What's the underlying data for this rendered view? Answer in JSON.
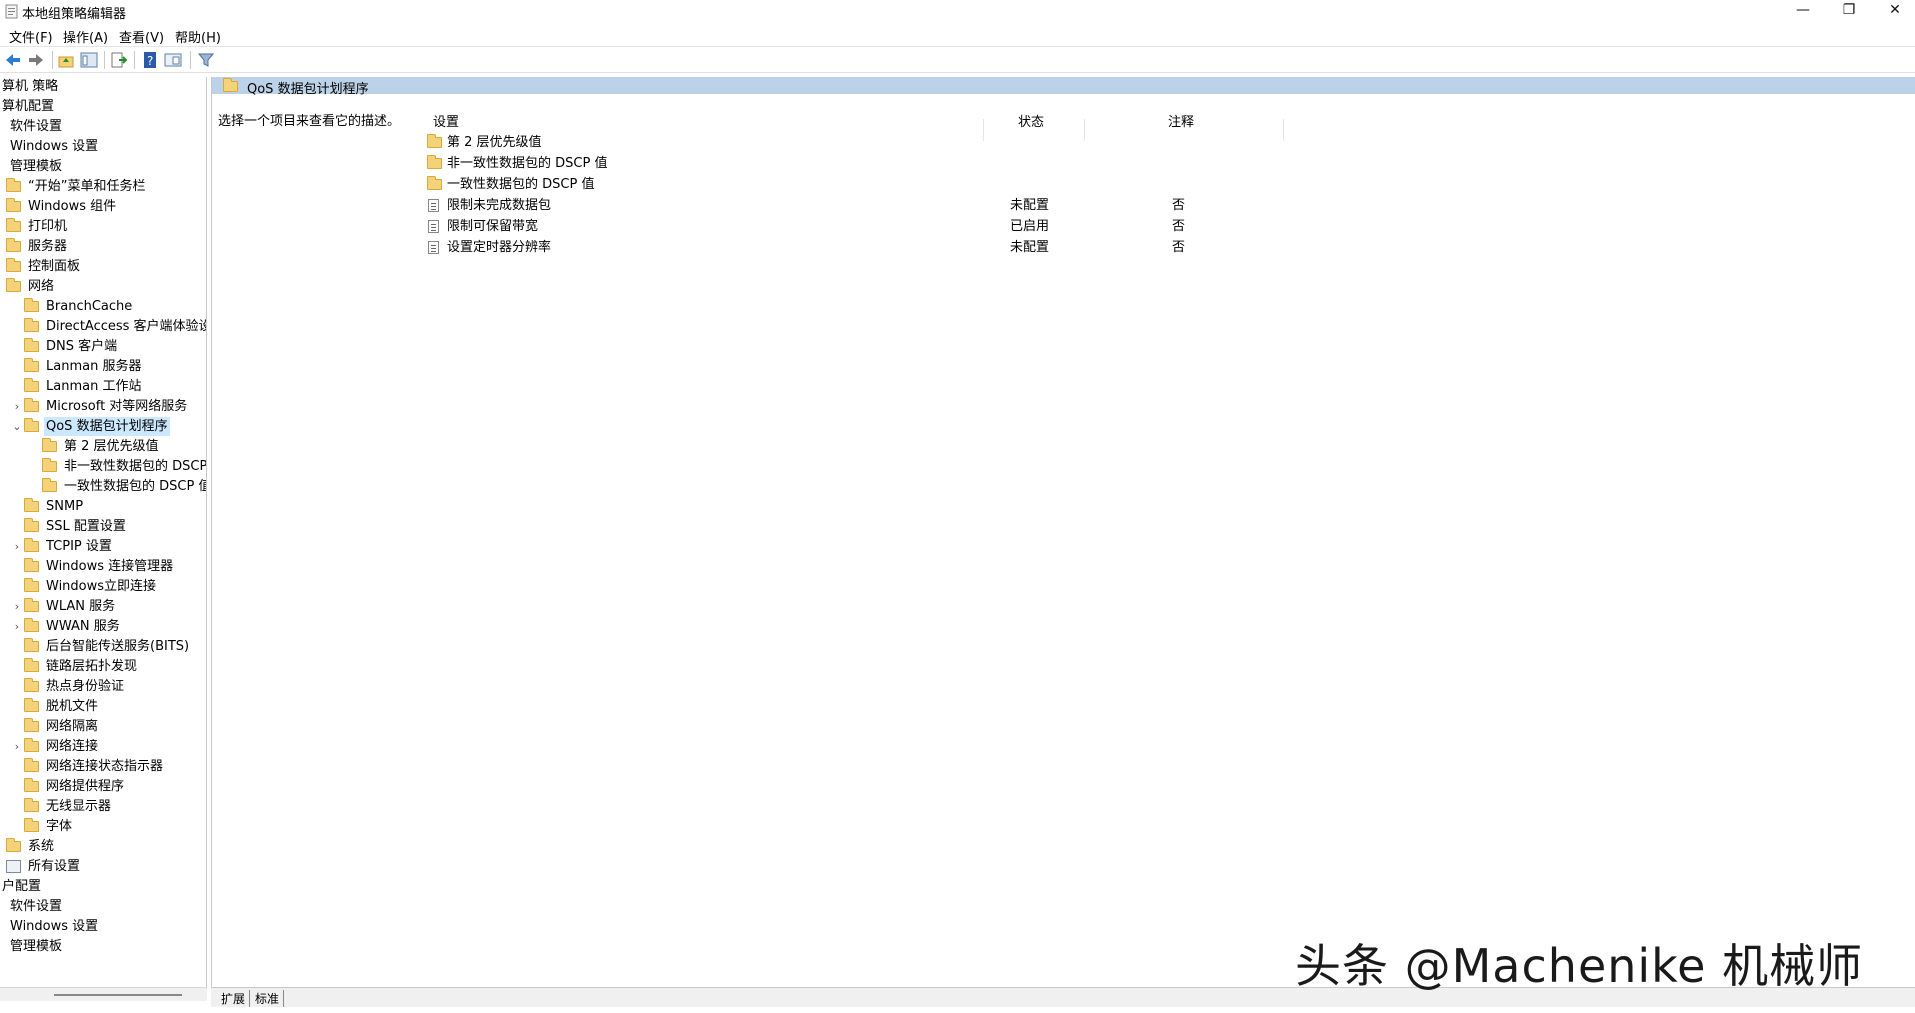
{
  "window": {
    "title": "本地组策略编辑器",
    "minimize_glyph": "—",
    "maximize_glyph": "❐",
    "close_glyph": "✕"
  },
  "menu": [
    "文件(F)",
    "操作(A)",
    "查看(V)",
    "帮助(H)"
  ],
  "toolbar": {
    "icons": [
      "back-arrow-icon",
      "forward-arrow-icon",
      "up-folder-icon",
      "show-hide-tree-icon",
      "export-list-icon",
      "help-icon",
      "properties-icon",
      "filter-icon"
    ]
  },
  "tree": {
    "items": [
      {
        "label": "算机 策略",
        "level": 0
      },
      {
        "label": "算机配置",
        "level": 0
      },
      {
        "label": "软件设置",
        "level": 1
      },
      {
        "label": "Windows 设置",
        "level": 1
      },
      {
        "label": "管理模板",
        "level": 1
      },
      {
        "label": "“开始”菜单和任务栏",
        "level": 2
      },
      {
        "label": "Windows 组件",
        "level": 2
      },
      {
        "label": "打印机",
        "level": 2
      },
      {
        "label": "服务器",
        "level": 2
      },
      {
        "label": "控制面板",
        "level": 2
      },
      {
        "label": "网络",
        "level": 2
      },
      {
        "label": "BranchCache",
        "level": 3
      },
      {
        "label": "DirectAccess 客户端体验设置",
        "level": 3
      },
      {
        "label": "DNS 客户端",
        "level": 3
      },
      {
        "label": "Lanman 服务器",
        "level": 3
      },
      {
        "label": "Lanman 工作站",
        "level": 3
      },
      {
        "label": "Microsoft 对等网络服务",
        "level": 3
      },
      {
        "label": "QoS 数据包计划程序",
        "level": 3
      },
      {
        "label": "第 2 层优先级值",
        "level": 4
      },
      {
        "label": "非一致性数据包的 DSCP 值",
        "level": 4
      },
      {
        "label": "一致性数据包的 DSCP 值",
        "level": 4
      },
      {
        "label": "SNMP",
        "level": 3
      },
      {
        "label": "SSL 配置设置",
        "level": 3
      },
      {
        "label": "TCPIP 设置",
        "level": 3
      },
      {
        "label": "Windows 连接管理器",
        "level": 3
      },
      {
        "label": "Windows立即连接",
        "level": 3
      },
      {
        "label": "WLAN 服务",
        "level": 3
      },
      {
        "label": "WWAN 服务",
        "level": 3
      },
      {
        "label": "后台智能传送服务(BITS)",
        "level": 3
      },
      {
        "label": "链路层拓扑发现",
        "level": 3
      },
      {
        "label": "热点身份验证",
        "level": 3
      },
      {
        "label": "脱机文件",
        "level": 3
      },
      {
        "label": "网络隔离",
        "level": 3
      },
      {
        "label": "网络连接",
        "level": 3
      },
      {
        "label": "网络连接状态指示器",
        "level": 3
      },
      {
        "label": "网络提供程序",
        "level": 3
      },
      {
        "label": "无线显示器",
        "level": 3
      },
      {
        "label": "字体",
        "level": 3
      },
      {
        "label": "系统",
        "level": 2
      },
      {
        "label": "所有设置",
        "level": 2
      },
      {
        "label": "户配置",
        "level": 0
      },
      {
        "label": "软件设置",
        "level": 1
      },
      {
        "label": "Windows 设置",
        "level": 1
      },
      {
        "label": "管理模板",
        "level": 1
      }
    ]
  },
  "right": {
    "header_title": "QoS 数据包计划程序",
    "description": "选择一个项目来查看它的描述。",
    "columns": {
      "setting": "设置",
      "state": "状态",
      "comment": "注释"
    },
    "rows": [
      {
        "name": "第 2 层优先级值",
        "type": "folder",
        "state": "",
        "comment": ""
      },
      {
        "name": "非一致性数据包的 DSCP 值",
        "type": "folder",
        "state": "",
        "comment": ""
      },
      {
        "name": "一致性数据包的 DSCP 值",
        "type": "folder",
        "state": "",
        "comment": ""
      },
      {
        "name": "限制未完成数据包",
        "type": "setting",
        "state": "未配置",
        "comment": "否"
      },
      {
        "name": "限制可保留带宽",
        "type": "setting",
        "state": "已启用",
        "comment": "否"
      },
      {
        "name": "设置定时器分辨率",
        "type": "setting",
        "state": "未配置",
        "comment": "否"
      }
    ]
  },
  "tabs": [
    "扩展",
    "标准"
  ],
  "watermark": "头条 @Machenike 机械师",
  "colors": {
    "header_band": "#bcd2e8",
    "selection": "#cce8ff",
    "folder": "#f3d27a"
  }
}
